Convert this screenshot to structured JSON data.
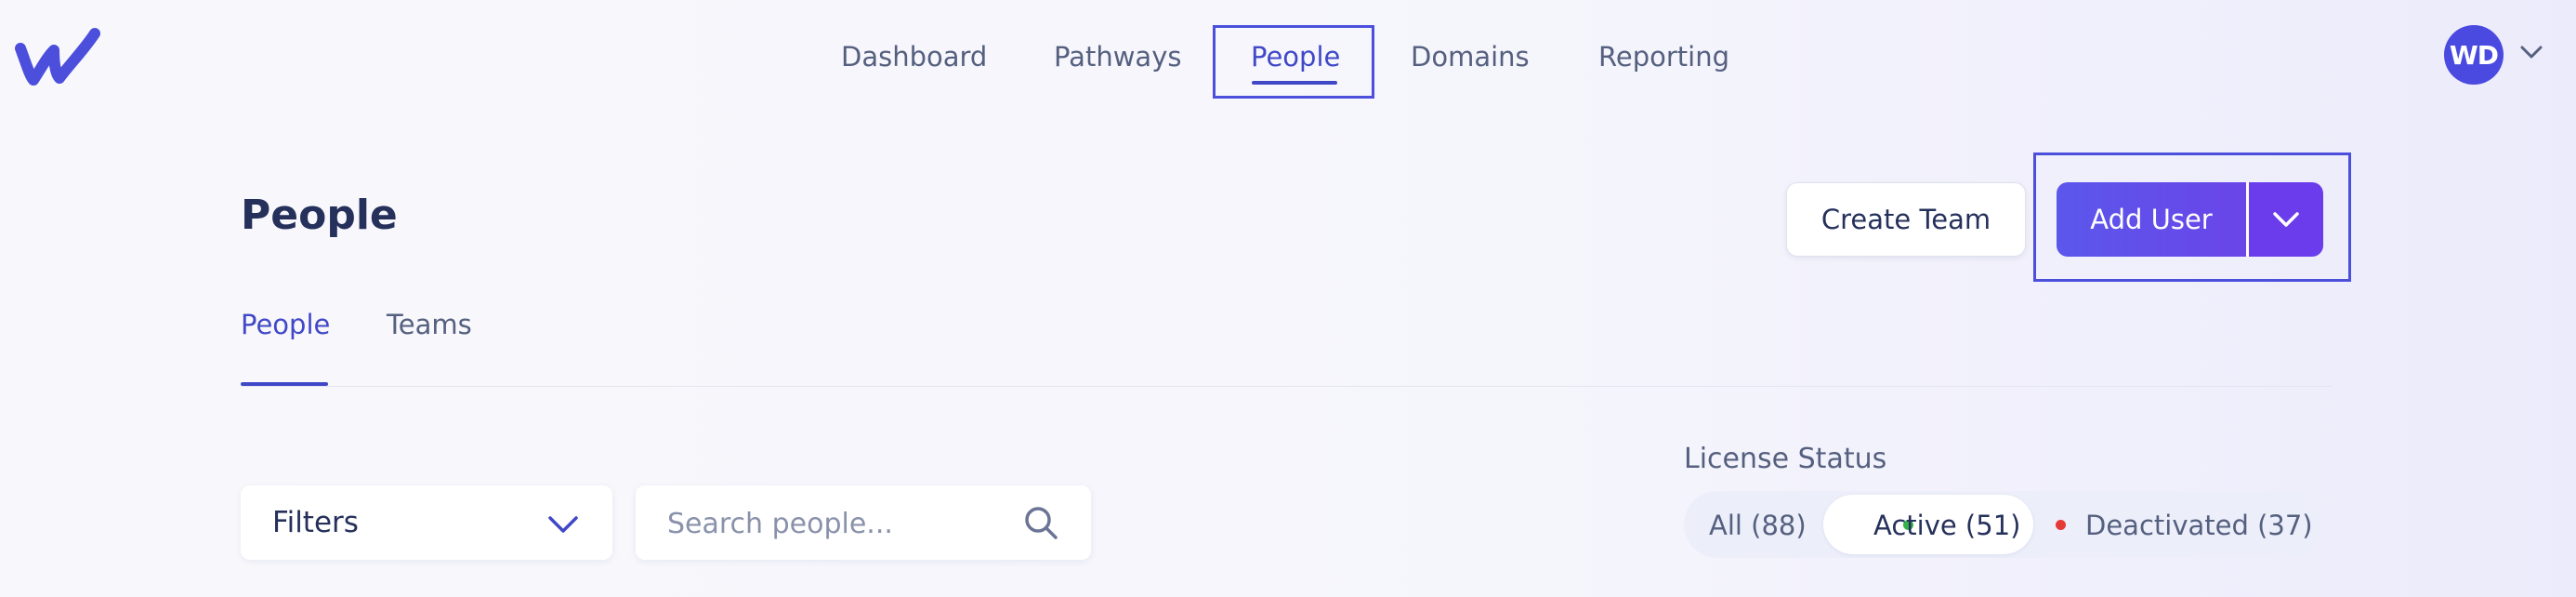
{
  "app": {
    "logo_icon": "wavy-w-logo",
    "brand_color": "#4b4fdc"
  },
  "nav": {
    "items": [
      {
        "label": "Dashboard",
        "active": false
      },
      {
        "label": "Pathways",
        "active": false
      },
      {
        "label": "People",
        "active": true
      },
      {
        "label": "Domains",
        "active": false
      },
      {
        "label": "Reporting",
        "active": false
      }
    ]
  },
  "user": {
    "initials": "WD",
    "avatar_color": "#4a4ae0",
    "menu_icon": "chevron-down-icon"
  },
  "page": {
    "title": "People"
  },
  "actions": {
    "create_team": "Create Team",
    "add_user": "Add User",
    "add_user_menu_icon": "chevron-down-icon"
  },
  "tabs": [
    {
      "label": "People",
      "active": true
    },
    {
      "label": "Teams",
      "active": false
    }
  ],
  "filters": {
    "label": "Filters",
    "icon": "chevron-down-icon"
  },
  "search": {
    "placeholder": "Search people...",
    "value": "",
    "icon": "search-icon"
  },
  "license_status": {
    "label": "License Status",
    "options": [
      {
        "label": "All (88)",
        "selected": false
      },
      {
        "label": "Active (51)",
        "selected": true,
        "dot_color": "#36b24a"
      },
      {
        "label": "Deactivated (37)",
        "selected": false,
        "dot_color": "#e53935"
      }
    ]
  }
}
